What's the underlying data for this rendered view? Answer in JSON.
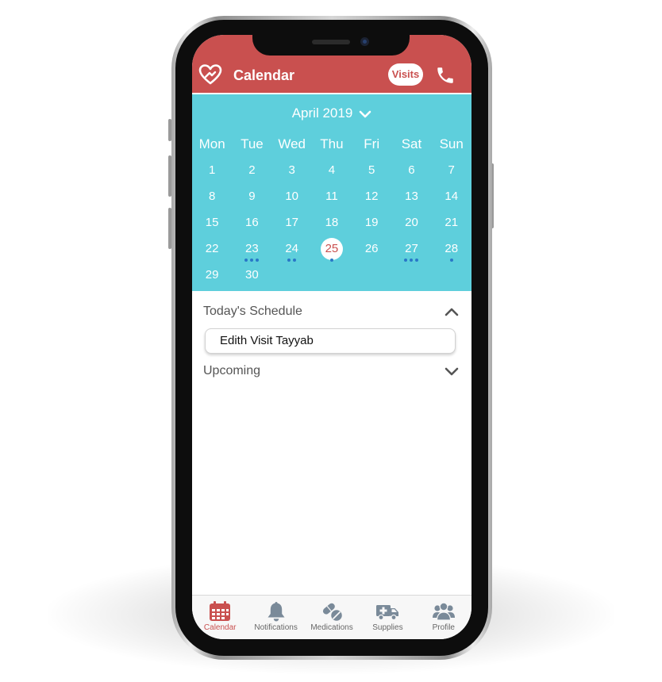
{
  "header": {
    "title": "Calendar",
    "visits_label": "Visits"
  },
  "calendar": {
    "month": "April 2019",
    "weekdays": [
      "Mon",
      "Tue",
      "Wed",
      "Thu",
      "Fri",
      "Sat",
      "Sun"
    ],
    "weeks": [
      [
        "1",
        "2",
        "3",
        "4",
        "5",
        "6",
        "7"
      ],
      [
        "8",
        "9",
        "10",
        "11",
        "12",
        "13",
        "14"
      ],
      [
        "15",
        "16",
        "17",
        "18",
        "19",
        "20",
        "21"
      ],
      [
        "22",
        "23",
        "24",
        "25",
        "26",
        "27",
        "28"
      ],
      [
        "29",
        "30",
        "",
        "",
        "",
        "",
        ""
      ]
    ],
    "today": "25",
    "event_dots": {
      "23": 3,
      "24": 2,
      "25": 1,
      "27": 3,
      "28": 1
    }
  },
  "schedule": {
    "today_label": "Today's Schedule",
    "today_items": [
      "Edith Visit Tayyab"
    ],
    "upcoming_label": "Upcoming"
  },
  "tabs": [
    {
      "label": "Calendar",
      "icon": "calendar-icon",
      "active": true
    },
    {
      "label": "Notifications",
      "icon": "bell-icon",
      "active": false
    },
    {
      "label": "Medications",
      "icon": "pills-icon",
      "active": false
    },
    {
      "label": "Supplies",
      "icon": "ambulance-icon",
      "active": false
    },
    {
      "label": "Profile",
      "icon": "users-icon",
      "active": false
    }
  ],
  "colors": {
    "brand_red": "#c9504f",
    "calendar_teal": "#5ecfdc",
    "event_dot_blue": "#2978c8",
    "inactive_icon": "#7a8a99"
  }
}
